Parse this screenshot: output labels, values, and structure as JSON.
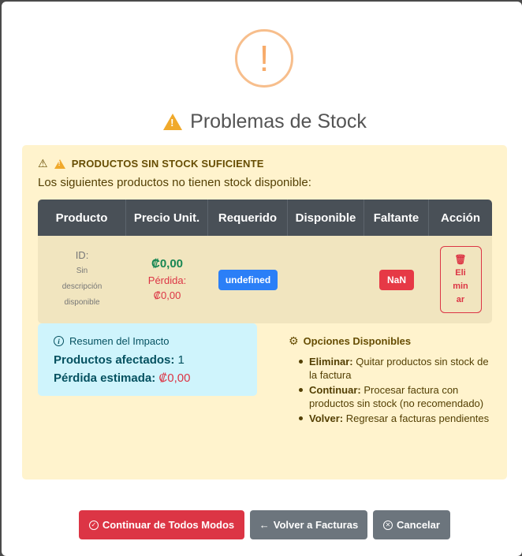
{
  "modal": {
    "title": "Problemas de Stock",
    "warning_icon": "exclamation-circle-icon"
  },
  "panel": {
    "heading": "PRODUCTOS SIN STOCK SUFICIENTE",
    "subtitle": "Los siguientes productos no tienen stock disponible:"
  },
  "table": {
    "headers": [
      "Producto",
      "Precio Unit.",
      "Requerido",
      "Disponible",
      "Faltante",
      "Acción"
    ],
    "rows": [
      {
        "id_label": "ID:",
        "description": "Sin descripción disponible",
        "price": "₡0,00",
        "loss_label": "Pérdida:",
        "loss_value": "₡0,00",
        "required": "undefined",
        "available": "",
        "missing": "NaN",
        "action": "Eliminar"
      }
    ]
  },
  "impact": {
    "heading": "Resumen del Impacto",
    "affected_label": "Productos afectados:",
    "affected_value": "1",
    "loss_label": "Pérdida estimada:",
    "loss_value": "₡0,00"
  },
  "options": {
    "heading": "Opciones Disponibles",
    "items": [
      {
        "label": "Eliminar:",
        "text": "Quitar productos sin stock de la factura"
      },
      {
        "label": "Continuar:",
        "text": "Procesar factura con productos sin stock (no recomendado)"
      },
      {
        "label": "Volver:",
        "text": "Regresar a facturas pendientes"
      }
    ]
  },
  "buttons": {
    "continue": "Continuar de Todos Modos",
    "back": "Volver a Facturas",
    "cancel": "Cancelar"
  },
  "colors": {
    "danger": "#dc3545",
    "warning_bg": "#fff3cd",
    "info_bg": "#cff4fc",
    "header_dark": "#495057",
    "secondary": "#6c757d",
    "success": "#198754",
    "primary_badge": "#2b7ff7"
  }
}
